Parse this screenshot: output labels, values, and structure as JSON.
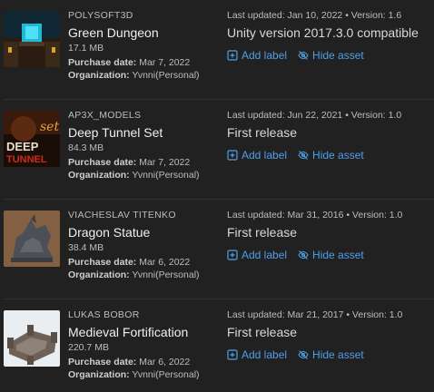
{
  "colors": {
    "background": "#212121",
    "link": "#4f9fe9",
    "divider": "#2f2f2f"
  },
  "labels": {
    "purchase_prefix": "Purchase date:",
    "org_prefix": "Organization:",
    "add_label": "Add label",
    "hide_asset": "Hide asset"
  },
  "assets": [
    {
      "publisher": "POLYSOFT3D",
      "title": "Green Dungeon",
      "size": "17.1 MB",
      "purchase_date": "Mar 7, 2022",
      "organization": "Yvnni(Personal)",
      "updated": "Last updated: Jan 10, 2022 • Version: 1.6",
      "release_notes": "Unity version 2017.3.0 compatible",
      "thumbnail_icon": "green-dungeon-thumbnail"
    },
    {
      "publisher": "AP3X_MODELS",
      "title": "Deep Tunnel Set",
      "size": "84.3 MB",
      "purchase_date": "Mar 7, 2022",
      "organization": "Yvnni(Personal)",
      "updated": "Last updated: Jun 22, 2021 • Version: 1.0",
      "release_notes": "First release",
      "thumbnail_icon": "deep-tunnel-thumbnail",
      "thumbnail_text": {
        "line1": "set",
        "line2": "DEEP",
        "line3": "TUNNEL"
      }
    },
    {
      "publisher": "VIACHESLAV TITENKO",
      "title": "Dragon Statue",
      "size": "38.4 MB",
      "purchase_date": "Mar 6, 2022",
      "organization": "Yvnni(Personal)",
      "updated": "Last updated: Mar 31, 2016 • Version: 1.0",
      "release_notes": "First release",
      "thumbnail_icon": "dragon-statue-thumbnail"
    },
    {
      "publisher": "LUKAS BOBOR",
      "title": "Medieval Fortification",
      "size": "220.7 MB",
      "purchase_date": "Mar 6, 2022",
      "organization": "Yvnni(Personal)",
      "updated": "Last updated: Mar 21, 2017 • Version: 1.0",
      "release_notes": "First release",
      "thumbnail_icon": "medieval-fortification-thumbnail"
    }
  ]
}
